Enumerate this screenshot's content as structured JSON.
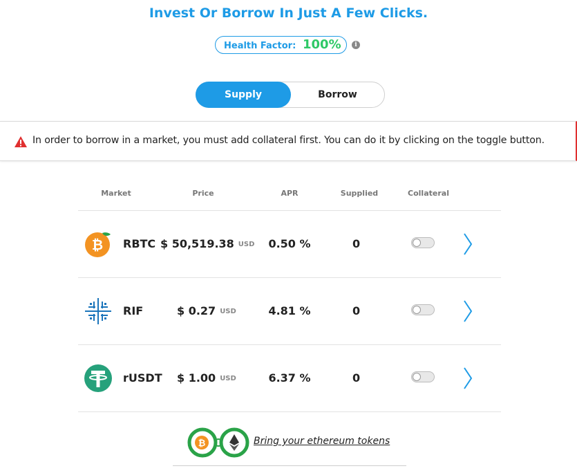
{
  "headline": "Invest Or Borrow In Just A Few Clicks.",
  "health": {
    "label": "Health Factor:",
    "value": "100%",
    "info_icon": "info-icon"
  },
  "mode_tabs": [
    {
      "label": "Supply",
      "active": true
    },
    {
      "label": "Borrow",
      "active": false
    }
  ],
  "alert": {
    "icon": "warning-icon",
    "text": "In order to borrow in a market, you must add collateral first. You can do it by clicking on the toggle button."
  },
  "table": {
    "headers": [
      "Market",
      "Price",
      "APR",
      "Supplied",
      "Collateral"
    ],
    "rows": [
      {
        "icon": "rbtc-icon",
        "symbol": "RBTC",
        "price": "$ 50,519.38",
        "unit": "USD",
        "apr": "0.50 %",
        "supplied": "0",
        "collateral": false
      },
      {
        "icon": "rif-icon",
        "symbol": "RIF",
        "price": "$ 0.27",
        "unit": "USD",
        "apr": "4.81 %",
        "supplied": "0",
        "collateral": false
      },
      {
        "icon": "rusdt-icon",
        "symbol": "rUSDT",
        "price": "$ 1.00",
        "unit": "USD",
        "apr": "6.37 %",
        "supplied": "0",
        "collateral": false
      }
    ]
  },
  "bridge": {
    "link_text": "Bring your ethereum tokens"
  },
  "colors": {
    "accent": "#1e9be6",
    "health_good": "#2ec866",
    "alert": "#e03030"
  }
}
